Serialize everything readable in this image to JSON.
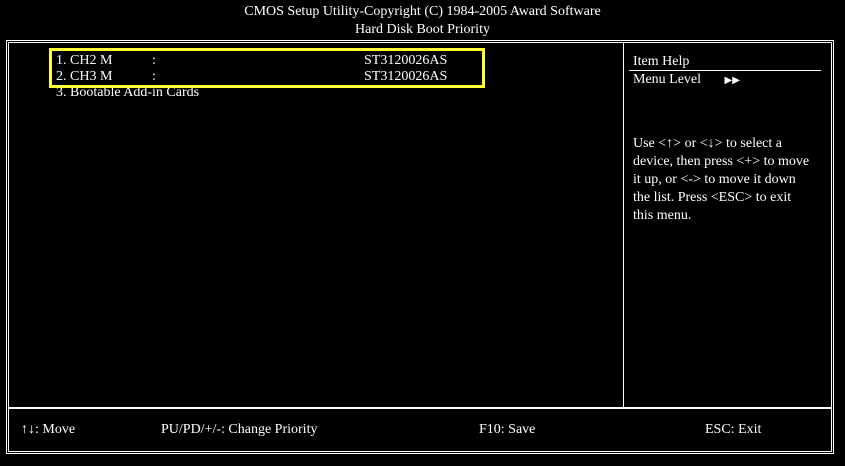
{
  "header": {
    "title": "CMOS Setup Utility-Copyright (C) 1984-2005 Award Software",
    "subtitle": "Hard Disk Boot Priority"
  },
  "devices": [
    {
      "label": "1. CH2 M",
      "colon": ":",
      "model": "ST3120026AS"
    },
    {
      "label": "2. CH3 M",
      "colon": ":",
      "model": "ST3120026AS"
    },
    {
      "label": "3. Bootable Add-in Cards",
      "colon": "",
      "model": ""
    }
  ],
  "help": {
    "title": "Item Help",
    "menu_level": "Menu Level",
    "menu_level_icon": "double-right-arrow-icon",
    "text": "Use <↑> or <↓> to select a device, then press <+> to move it up, or <-> to move it down the list. Press <ESC> to exit this menu."
  },
  "footer": {
    "move": "↑↓: Move",
    "priority": "PU/PD/+/-: Change Priority",
    "save": "F10: Save",
    "exit": "ESC: Exit"
  },
  "colors": {
    "background": "#000000",
    "text": "#ffffff",
    "highlight": "#ffff33"
  }
}
